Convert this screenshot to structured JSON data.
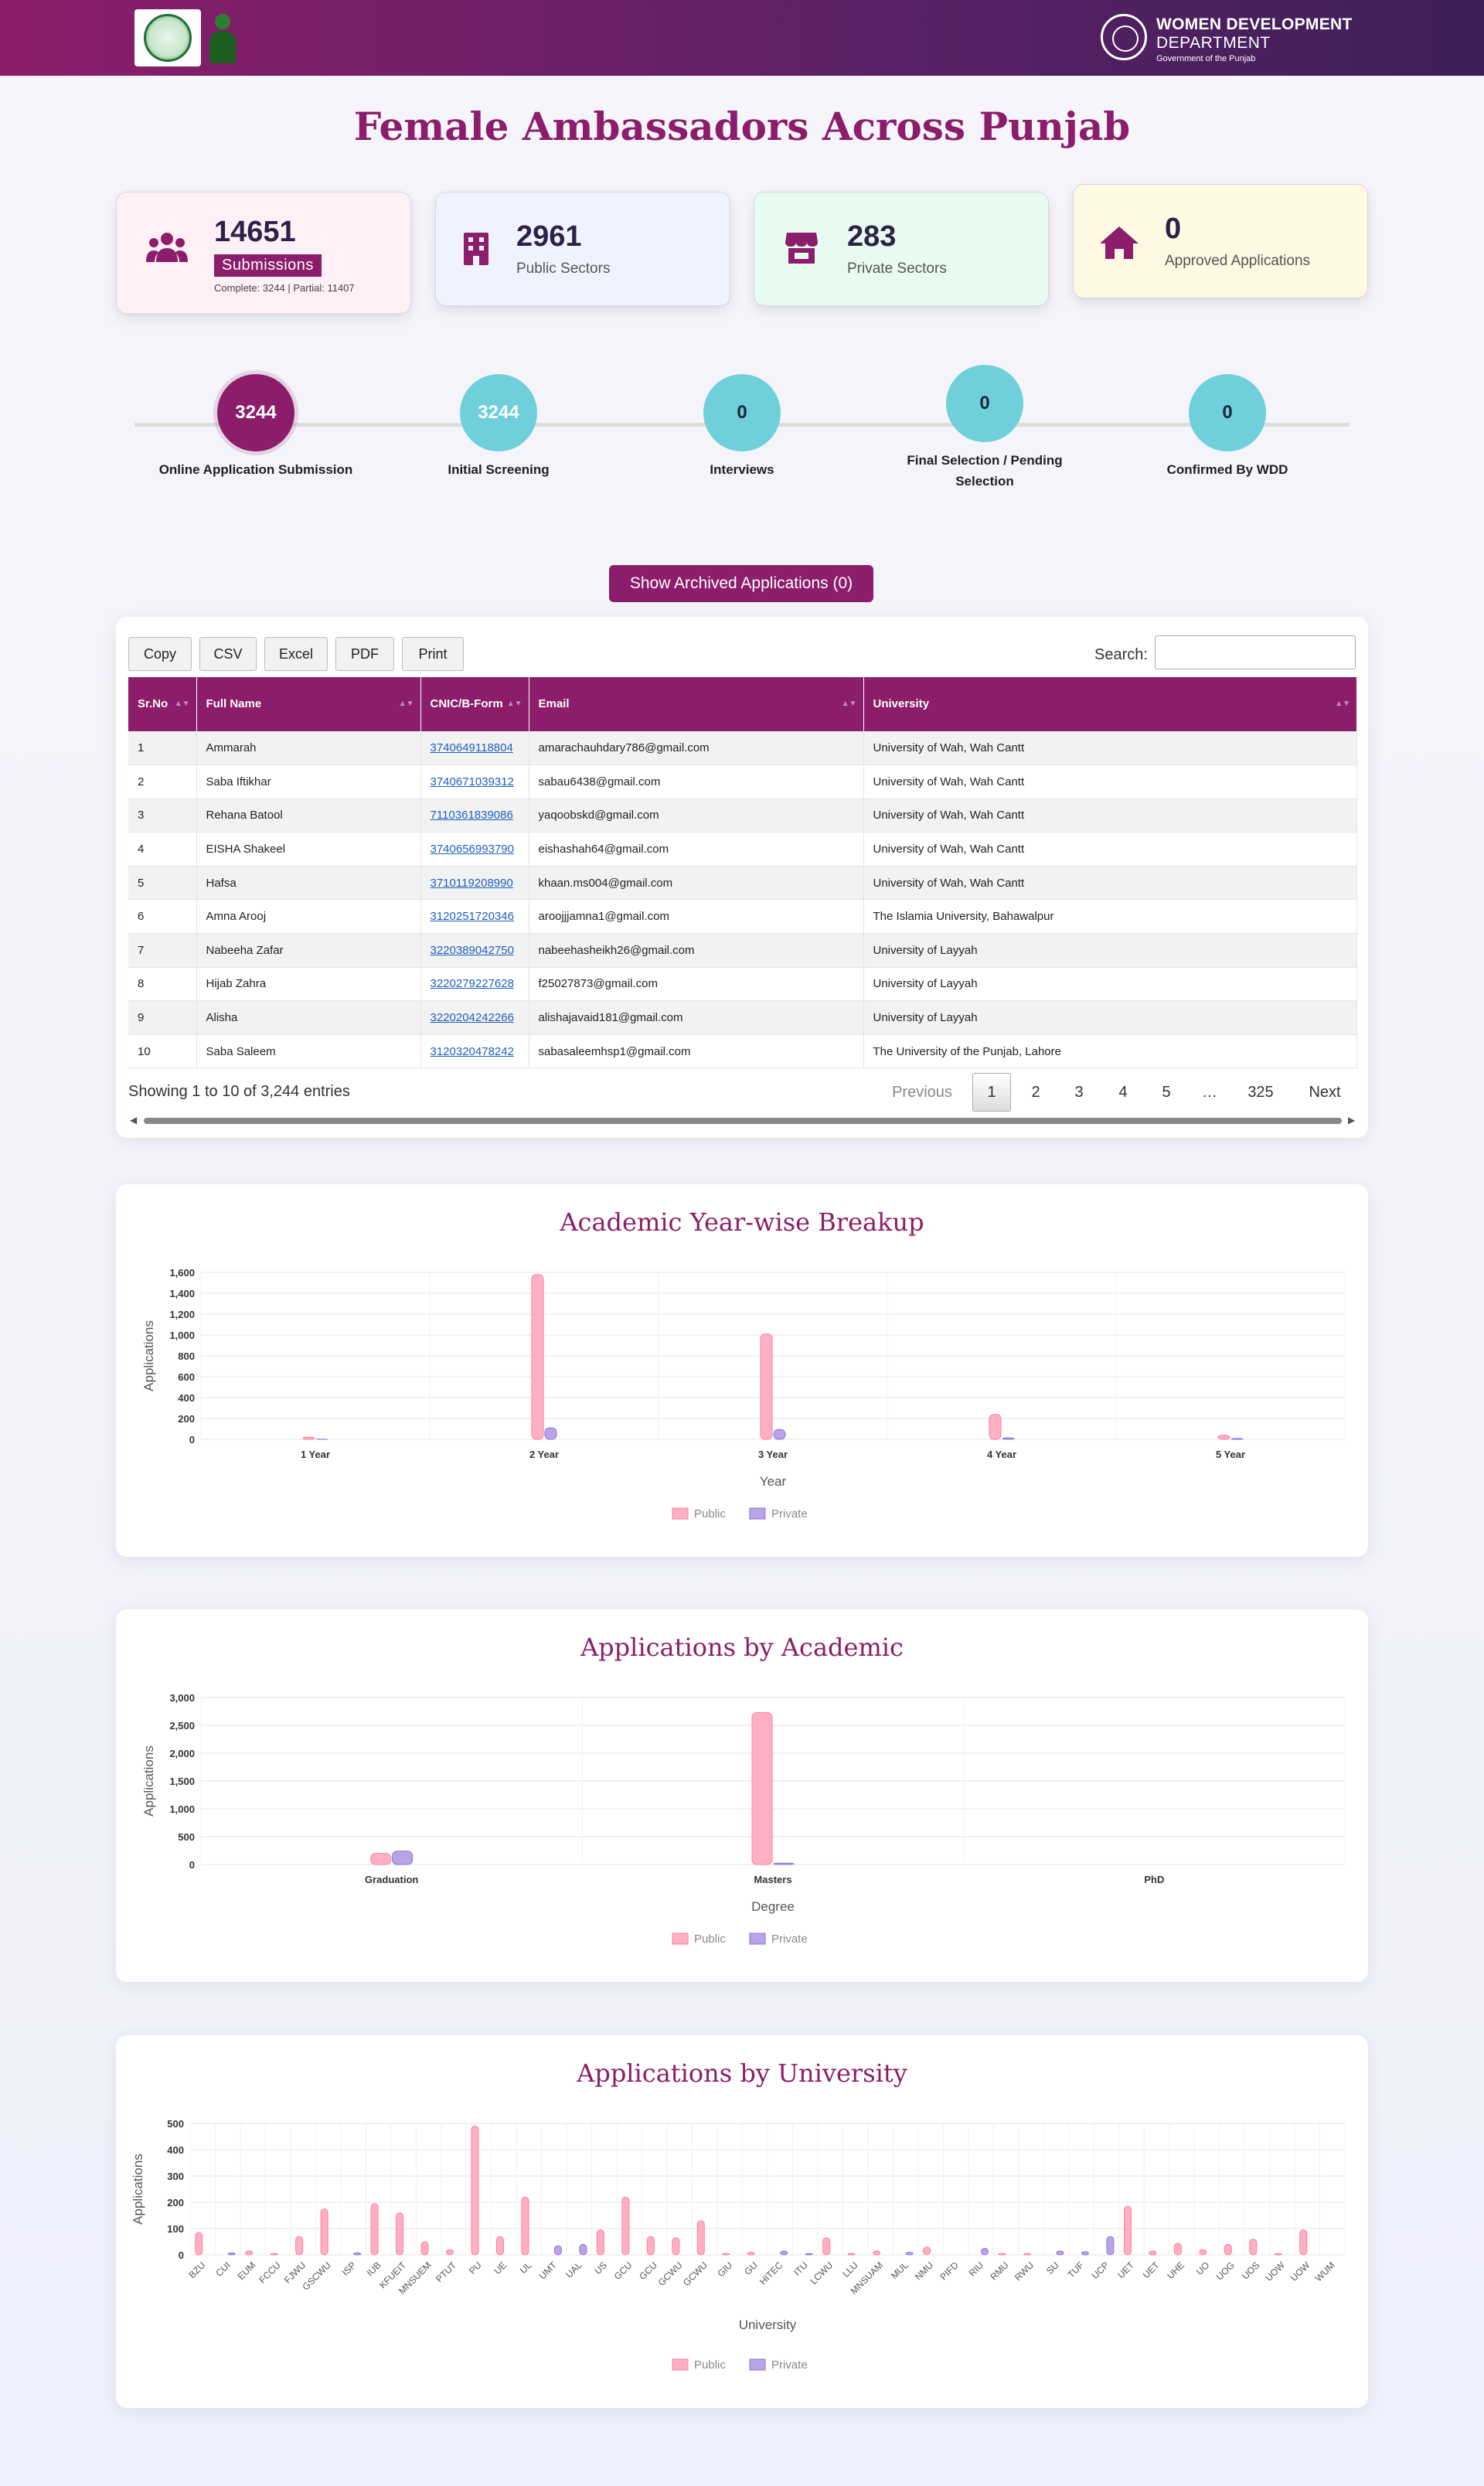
{
  "header": {
    "dept_line1": "WOMEN DEVELOPMENT",
    "dept_line2": "DEPARTMENT",
    "dept_line3": "Government of the Punjab"
  },
  "page_title": "Female Ambassadors Across Punjab",
  "stats": {
    "submissions": {
      "value": "14651",
      "label": "Submissions",
      "detail": "Complete: 3244 | Partial: 11407",
      "icon": "users-icon"
    },
    "public": {
      "value": "2961",
      "label": "Public Sectors",
      "icon": "building-icon"
    },
    "private": {
      "value": "283",
      "label": "Private Sectors",
      "icon": "store-icon"
    },
    "approved": {
      "value": "0",
      "label": "Approved Applications",
      "icon": "home-icon"
    }
  },
  "steps": [
    {
      "value": "3244",
      "label": "Online Application Submission"
    },
    {
      "value": "3244",
      "label": "Initial Screening"
    },
    {
      "value": "0",
      "label": "Interviews"
    },
    {
      "value": "0",
      "label": "Final Selection / Pending Selection"
    },
    {
      "value": "0",
      "label": "Confirmed By WDD"
    }
  ],
  "archived_button": "Show Archived Applications (0)",
  "table": {
    "buttons": [
      "Copy",
      "CSV",
      "Excel",
      "PDF",
      "Print"
    ],
    "search_label": "Search:",
    "columns": [
      "Sr.No",
      "Full Name",
      "CNIC/B-Form",
      "Email",
      "University"
    ],
    "rows": [
      [
        "1",
        "Ammarah",
        "3740649118804",
        "amarachauhdary786@gmail.com",
        "University of Wah, Wah Cantt"
      ],
      [
        "2",
        "Saba Iftikhar",
        "3740671039312",
        "sabau6438@gmail.com",
        "University of Wah, Wah Cantt"
      ],
      [
        "3",
        "Rehana Batool",
        "7110361839086",
        "yaqoobskd@gmail.com",
        "University of Wah, Wah Cantt"
      ],
      [
        "4",
        "EISHA Shakeel",
        "3740656993790",
        "eishashah64@gmail.com",
        "University of Wah, Wah Cantt"
      ],
      [
        "5",
        "Hafsa",
        "3710119208990",
        "khaan.ms004@gmail.com",
        "University of Wah, Wah Cantt"
      ],
      [
        "6",
        "Amna Arooj",
        "3120251720346",
        "aroojjjamna1@gmail.com",
        "The Islamia University, Bahawalpur"
      ],
      [
        "7",
        "Nabeeha Zafar",
        "3220389042750",
        "nabeehasheikh26@gmail.com",
        "University of Layyah"
      ],
      [
        "8",
        "Hijab Zahra",
        "3220279227628",
        "f25027873@gmail.com",
        "University of Layyah"
      ],
      [
        "9",
        "Alisha",
        "3220204242266",
        "alishajavaid181@gmail.com",
        "University of Layyah"
      ],
      [
        "10",
        "Saba Saleem",
        "3120320478242",
        "sabasaleemhsp1@gmail.com",
        "The University of the Punjab, Lahore"
      ]
    ],
    "showing": "Showing 1 to 10 of 3,244 entries",
    "pagination": [
      "Previous",
      "1",
      "2",
      "3",
      "4",
      "5",
      "…",
      "325",
      "Next"
    ]
  },
  "colors": {
    "brand": "#8b1d6a",
    "public": "#ffb0c4",
    "private": "#b8a4e6"
  },
  "chart_data": [
    {
      "type": "bar",
      "title": "Academic Year-wise Breakup",
      "xlabel": "Year",
      "ylabel": "Applications",
      "categories": [
        "1 Year",
        "2 Year",
        "3 Year",
        "4 Year",
        "5 Year"
      ],
      "ylim": [
        0,
        1600
      ],
      "yticks": [
        "0",
        "200",
        "400",
        "600",
        "800",
        "1,000",
        "1,200",
        "1,400",
        "1,600"
      ],
      "series": [
        {
          "name": "Public",
          "values": [
            20,
            1580,
            1010,
            240,
            40
          ]
        },
        {
          "name": "Private",
          "values": [
            2,
            110,
            95,
            15,
            8
          ]
        }
      ],
      "legend": "bottom",
      "grid": true
    },
    {
      "type": "bar",
      "title": "Applications by Academic",
      "xlabel": "Degree",
      "ylabel": "Applications",
      "categories": [
        "Graduation",
        "Masters",
        "PhD"
      ],
      "ylim": [
        0,
        3000
      ],
      "yticks": [
        "0",
        "500",
        "1,000",
        "1,500",
        "2,000",
        "2,500",
        "3,000"
      ],
      "series": [
        {
          "name": "Public",
          "values": [
            200,
            2730,
            0
          ]
        },
        {
          "name": "Private",
          "values": [
            240,
            25,
            0
          ]
        }
      ],
      "legend": "bottom",
      "grid": true
    },
    {
      "type": "bar",
      "title": "Applications by University",
      "xlabel": "University",
      "ylabel": "Applications",
      "categories": [
        "BZU",
        "CUI",
        "EUM",
        "FCCU",
        "FJWU",
        "GSCWU",
        "ISP",
        "IUB",
        "KFUEIT",
        "MNSUEM",
        "PTUT",
        "PU",
        "UE",
        "UL",
        "UMT",
        "UAL",
        "US",
        "GCU",
        "GCU",
        "GCWU",
        "GCWU",
        "GIU",
        "GU",
        "HITEC",
        "ITU",
        "LCWU",
        "LLU",
        "MNSUAM",
        "MUL",
        "NMU",
        "PIFD",
        "RIU",
        "RMU",
        "RWU",
        "SU",
        "TUF",
        "UCP",
        "UET",
        "UET",
        "UHE",
        "UO",
        "UOG",
        "UOS",
        "UOW",
        "UOW",
        "WUM"
      ],
      "ylim": [
        0,
        500
      ],
      "yticks": [
        "0",
        "100",
        "200",
        "300",
        "400",
        "500"
      ],
      "series": [
        {
          "name": "Public",
          "values": [
            85,
            0,
            15,
            5,
            70,
            175,
            0,
            195,
            160,
            50,
            20,
            490,
            70,
            220,
            0,
            0,
            95,
            220,
            70,
            65,
            130,
            5,
            10,
            0,
            0,
            65,
            5,
            15,
            0,
            30,
            0,
            0,
            5,
            5,
            0,
            0,
            0,
            185,
            15,
            45,
            20,
            40,
            60,
            5,
            95,
            0
          ]
        },
        {
          "name": "Private",
          "values": [
            0,
            8,
            0,
            0,
            0,
            0,
            8,
            0,
            0,
            0,
            0,
            0,
            0,
            0,
            35,
            40,
            0,
            0,
            0,
            0,
            0,
            0,
            0,
            15,
            5,
            0,
            0,
            0,
            10,
            0,
            0,
            25,
            0,
            0,
            15,
            12,
            70,
            0,
            0,
            0,
            0,
            0,
            0,
            0,
            0,
            0
          ]
        }
      ],
      "legend": "bottom",
      "grid": true
    }
  ]
}
